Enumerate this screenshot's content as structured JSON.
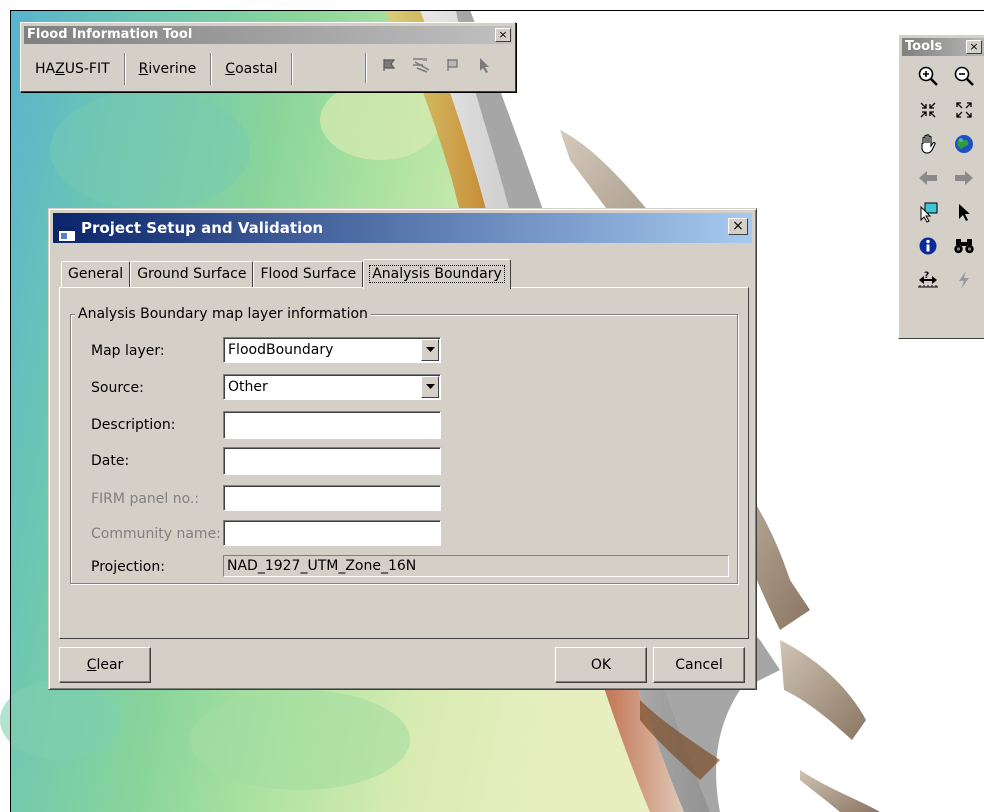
{
  "flood_tool": {
    "title": "Flood Information Tool",
    "menu": [
      {
        "pre": "HA",
        "accel": "Z",
        "post": "US-FIT"
      },
      {
        "pre": "",
        "accel": "R",
        "post": "iverine"
      },
      {
        "pre": "",
        "accel": "C",
        "post": "oastal"
      }
    ],
    "tool_icons": [
      "flag-tool-icon",
      "tree-select-tool-icon",
      "flag-outline-tool-icon",
      "pointer-tool-icon"
    ],
    "close_glyph": "×"
  },
  "tools_palette": {
    "title": "Tools",
    "close_glyph": "×",
    "icons": [
      "zoom-in-icon",
      "zoom-out-icon",
      "fixed-zoom-in-icon",
      "fixed-zoom-out-icon",
      "pan-hand-icon",
      "full-extent-globe-icon",
      "back-arrow-icon",
      "forward-arrow-icon",
      "select-features-icon",
      "select-element-icon",
      "identify-icon",
      "find-binoculars-icon",
      "measure-icon",
      "hyperlink-lightning-icon"
    ]
  },
  "dialog": {
    "title": "Project Setup and Validation",
    "close_glyph": "×",
    "tabs": [
      "General",
      "Ground Surface",
      "Flood Surface",
      "Analysis Boundary"
    ],
    "active_tab": "Analysis Boundary",
    "group_title": "Analysis Boundary map layer information",
    "fields": {
      "map_layer": {
        "label": "Map layer:",
        "value": "FloodBoundary"
      },
      "source": {
        "label": "Source:",
        "value": "Other"
      },
      "description": {
        "label": "Description:",
        "value": ""
      },
      "date": {
        "label": "Date:",
        "value": ""
      },
      "firm_panel": {
        "label": "FIRM panel no.:",
        "value": ""
      },
      "community": {
        "label": "Community name:",
        "value": ""
      },
      "projection": {
        "label": "Projection:",
        "value": "NAD_1927_UTM_Zone_16N"
      }
    },
    "buttons": {
      "clear": {
        "accel": "C",
        "rest": "lear"
      },
      "ok": "OK",
      "cancel": "Cancel"
    }
  }
}
